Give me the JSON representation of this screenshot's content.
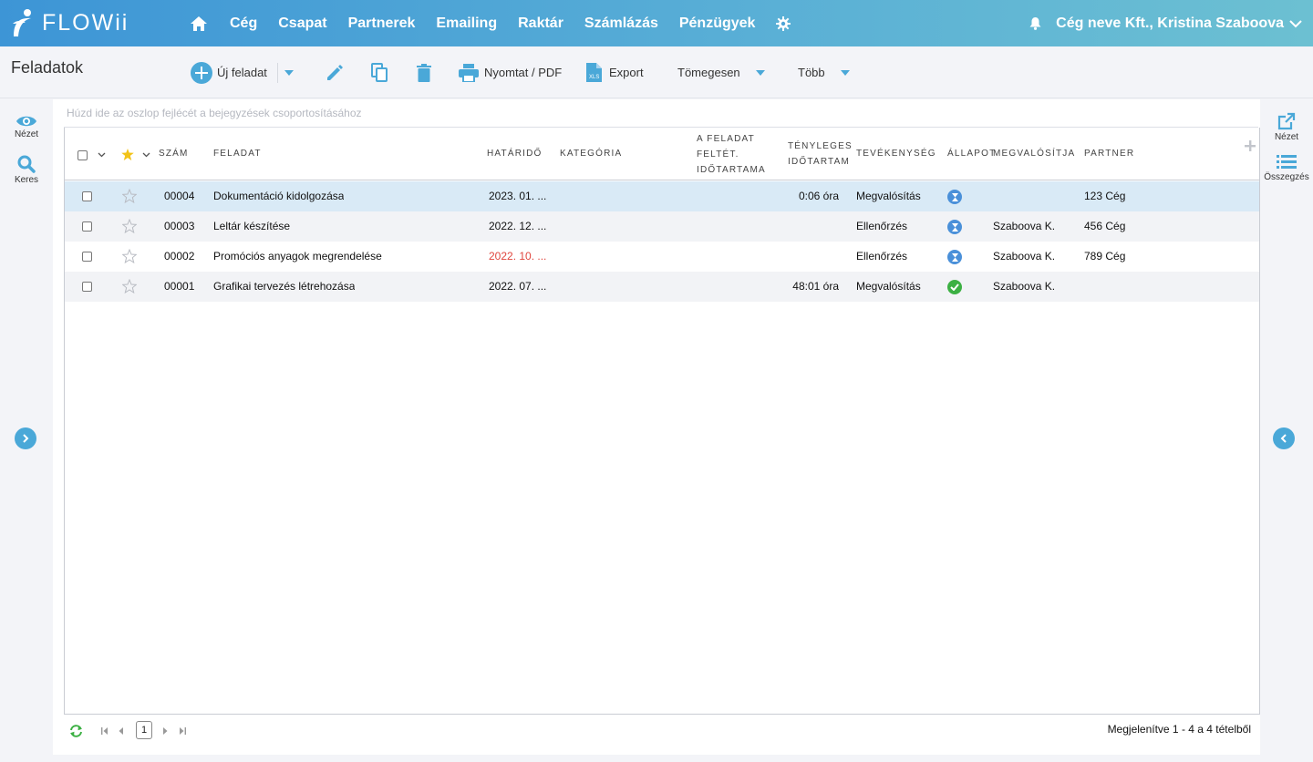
{
  "app": {
    "logo_text": "FLOWii",
    "nav": [
      "Cég",
      "Csapat",
      "Partnerek",
      "Emailing",
      "Raktár",
      "Számlázás",
      "Pénzügyek"
    ],
    "user_label": "Cég neve Kft., Kristina Szaboova",
    "brand_color": "#3d95d6"
  },
  "toolbar": {
    "page_title": "Feladatok",
    "new_task": "Új feladat",
    "print": "Nyomtat / PDF",
    "export": "Export",
    "bulk": "Tömegesen",
    "more": "Több"
  },
  "side_left": {
    "view": "Nézet",
    "search": "Keres"
  },
  "side_right": {
    "view": "Nézet",
    "summary": "Összegzés"
  },
  "grid": {
    "group_hint": "Húzd ide az oszlop fejlécét a bejegyzések csoportosításához",
    "columns": {
      "num": "Szám",
      "task": "Feladat",
      "deadline": "Határidő",
      "category": "Kategória",
      "est_line1": "A feladat",
      "est_line2": "feltét.",
      "est_line3": "időtartama",
      "actual_line1": "Tényleges",
      "actual_line2": "időtartam",
      "activity": "Tevékenység",
      "status": "Állapot",
      "assignee": "Megvalósítja",
      "partner": "Partner"
    },
    "rows": [
      {
        "num": "00004",
        "task": "Dokumentáció kidolgozása",
        "deadline": "2023. 01. ...",
        "deadline_overdue": false,
        "category": "",
        "estimated": "",
        "actual": "0:06 óra",
        "activity": "Megvalósítás",
        "status": "in-progress",
        "assignee": "",
        "partner": "123 Cég",
        "starred": false
      },
      {
        "num": "00003",
        "task": "Leltár készítése",
        "deadline": "2022. 12. ...",
        "deadline_overdue": false,
        "category": "",
        "estimated": "",
        "actual": "",
        "activity": "Ellenőrzés",
        "status": "in-progress",
        "assignee": "Szaboova K.",
        "partner": "456 Cég",
        "starred": false
      },
      {
        "num": "00002",
        "task": "Promóciós anyagok megrendelése",
        "deadline": "2022. 10. ...",
        "deadline_overdue": true,
        "category": "",
        "estimated": "",
        "actual": "",
        "activity": "Ellenőrzés",
        "status": "in-progress",
        "assignee": "Szaboova K.",
        "partner": "789 Cég",
        "starred": false
      },
      {
        "num": "00001",
        "task": "Grafikai tervezés létrehozása",
        "deadline": "2022. 07. ...",
        "deadline_overdue": false,
        "category": "",
        "estimated": "",
        "actual": "48:01 óra",
        "activity": "Megvalósítás",
        "status": "done",
        "assignee": "Szaboova K.",
        "partner": "",
        "starred": false
      }
    ],
    "status_colors": {
      "in-progress": "#4a90d9",
      "done": "#3cb043"
    },
    "overdue_color": "#e0463e"
  },
  "pager": {
    "current_page": "1",
    "info": "Megjelenítve 1 - 4 a 4 tételből"
  }
}
